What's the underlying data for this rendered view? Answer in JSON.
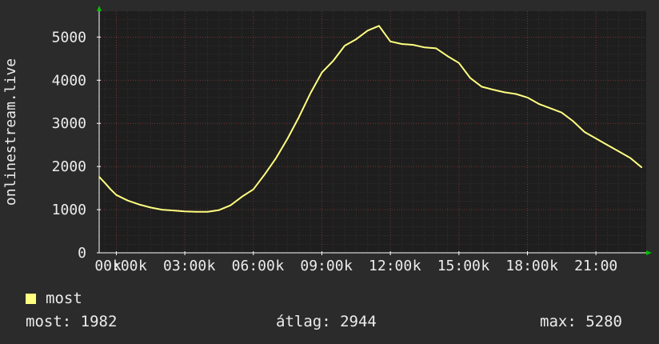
{
  "chart_data": {
    "type": "line",
    "ylabel": "onlinestream.live",
    "xlabel": "",
    "ylim": [
      0,
      5600
    ],
    "y_ticks": [
      0,
      1000,
      2000,
      3000,
      4000,
      5000
    ],
    "y_tick_labels": [
      "0",
      "1000",
      "2000",
      "3000",
      "4000",
      "5000"
    ],
    "x_range_hours": [
      -0.75,
      23.2
    ],
    "x_ticks_hours": [
      0,
      3,
      6,
      9,
      12,
      15,
      18,
      21
    ],
    "x_tick_labels": [
      "00:00",
      "03:00",
      "06:00",
      "09:00",
      "12:00",
      "15:00",
      "18:00",
      "21:00"
    ],
    "x_tick_prefix_label": "k",
    "grid": true,
    "series": [
      {
        "name": "most",
        "color": "#ffff80",
        "x_hours": [
          -0.75,
          -0.5,
          -0.25,
          0,
          0.5,
          1,
          1.5,
          2,
          2.5,
          3,
          3.5,
          4,
          4.5,
          5,
          5.5,
          6,
          6.5,
          7,
          7.5,
          8,
          8.5,
          9,
          9.5,
          10,
          10.5,
          11,
          11.5,
          12,
          12.5,
          13,
          13.5,
          14,
          14.5,
          15,
          15.5,
          16,
          16.5,
          17,
          17.5,
          18,
          18.5,
          19,
          19.5,
          20,
          20.5,
          21,
          21.5,
          22,
          22.5,
          23
        ],
        "values": [
          1760,
          1620,
          1470,
          1340,
          1210,
          1120,
          1050,
          1000,
          980,
          960,
          950,
          950,
          990,
          1100,
          1300,
          1470,
          1820,
          2200,
          2650,
          3150,
          3700,
          4180,
          4450,
          4800,
          4950,
          5150,
          5260,
          4900,
          4840,
          4820,
          4760,
          4740,
          4560,
          4400,
          4050,
          3850,
          3780,
          3720,
          3680,
          3600,
          3450,
          3350,
          3250,
          3050,
          2800,
          2650,
          2500,
          2350,
          2200,
          1980
        ]
      }
    ],
    "legend_position": "bottom-left"
  },
  "legend": {
    "label": "most"
  },
  "stats": {
    "most": "most: 1982",
    "atlag": "átlag: 2944",
    "max": "max: 5280"
  }
}
